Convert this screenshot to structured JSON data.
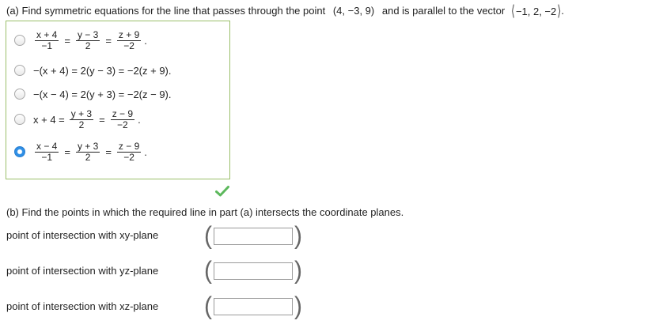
{
  "part_a": {
    "question": "(a) Find symmetric equations for the line that passes through the point",
    "point": "(4, −3, 9)",
    "mid": "and is parallel to the vector",
    "vector": "−1, 2, −2",
    "end": ".",
    "options": [
      {
        "parts": [
          {
            "type": "frac",
            "num": "x + 4",
            "den": "−1"
          },
          {
            "type": "eq",
            "text": "="
          },
          {
            "type": "frac",
            "num": "y − 3",
            "den": "2"
          },
          {
            "type": "eq",
            "text": "="
          },
          {
            "type": "frac",
            "num": "z + 9",
            "den": "−2"
          },
          {
            "type": "text",
            "text": "."
          }
        ],
        "selected": false
      },
      {
        "parts": [
          {
            "type": "text",
            "text": "−(x + 4) = 2(y − 3) = −2(z + 9)."
          }
        ],
        "selected": false
      },
      {
        "parts": [
          {
            "type": "text",
            "text": "−(x − 4) = 2(y + 3) = −2(z − 9)."
          }
        ],
        "selected": false
      },
      {
        "parts": [
          {
            "type": "text",
            "text": "x + 4 ="
          },
          {
            "type": "frac",
            "num": "y + 3",
            "den": "2"
          },
          {
            "type": "eq",
            "text": "="
          },
          {
            "type": "frac",
            "num": "z − 9",
            "den": "−2"
          },
          {
            "type": "text",
            "text": "."
          }
        ],
        "selected": false
      },
      {
        "parts": [
          {
            "type": "frac",
            "num": "x − 4",
            "den": "−1"
          },
          {
            "type": "eq",
            "text": "="
          },
          {
            "type": "frac",
            "num": "y + 3",
            "den": "2"
          },
          {
            "type": "eq",
            "text": "="
          },
          {
            "type": "frac",
            "num": "z − 9",
            "den": "−2"
          },
          {
            "type": "text",
            "text": "."
          }
        ],
        "selected": true
      }
    ],
    "correct_icon": "checkmark-icon",
    "accent_color": "#5cb85c"
  },
  "part_b": {
    "question": "(b) Find the points in which the required line in part (a) intersects the coordinate planes.",
    "rows": [
      {
        "label": "point of intersection with xy-plane",
        "value": ""
      },
      {
        "label": "point of intersection with yz-plane",
        "value": ""
      },
      {
        "label": "point of intersection with xz-plane",
        "value": ""
      }
    ]
  }
}
